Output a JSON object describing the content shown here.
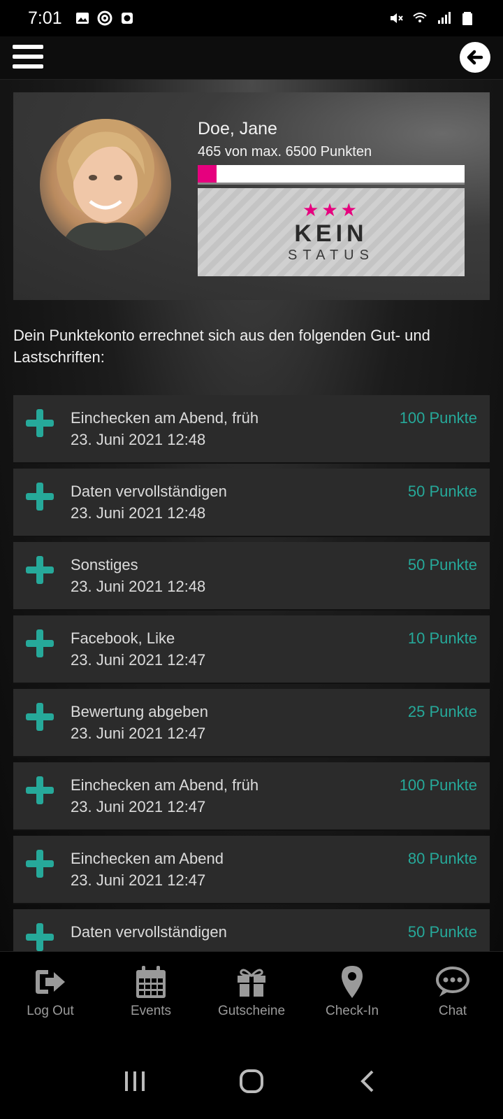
{
  "status_bar": {
    "time": "7:01",
    "icons_left": [
      "image-icon",
      "at-icon",
      "clock-icon"
    ],
    "icons_right": [
      "mute-icon",
      "wifi-icon",
      "signal-icon",
      "battery-icon"
    ]
  },
  "app_bar": {
    "menu_icon": "hamburger-icon",
    "back_icon": "back-arrow-icon"
  },
  "profile": {
    "name": "Doe, Jane",
    "points_text": "465  von max. 6500 Punkten",
    "progress_fraction": 0.0715,
    "badge": {
      "title": "KEIN",
      "subtitle": "STATUS",
      "stars": "★★★",
      "star_color": "#e6007e"
    }
  },
  "intro_text": "Dein Punktekonto errechnet sich aus den folgenden Gut- und Lastschriften:",
  "transactions": [
    {
      "title": "Einchecken am Abend, früh",
      "date": "23. Juni 2021 12:48",
      "points": "100 Punkte"
    },
    {
      "title": "Daten vervollständigen",
      "date": "23. Juni 2021 12:48",
      "points": "50 Punkte"
    },
    {
      "title": "Sonstiges",
      "date": "23. Juni 2021 12:48",
      "points": "50 Punkte"
    },
    {
      "title": "Facebook, Like",
      "date": "23. Juni 2021 12:47",
      "points": "10 Punkte"
    },
    {
      "title": "Bewertung abgeben",
      "date": "23. Juni 2021 12:47",
      "points": "25 Punkte"
    },
    {
      "title": "Einchecken am Abend, früh",
      "date": "23. Juni 2021 12:47",
      "points": "100 Punkte"
    },
    {
      "title": "Einchecken am Abend",
      "date": "23. Juni 2021 12:47",
      "points": "80 Punkte"
    },
    {
      "title": "Daten vervollständigen",
      "date": "",
      "points": "50 Punkte"
    }
  ],
  "bottom_nav": [
    {
      "label": "Log Out",
      "icon": "logout-icon"
    },
    {
      "label": "Events",
      "icon": "calendar-icon"
    },
    {
      "label": "Gutscheine",
      "icon": "gift-icon"
    },
    {
      "label": "Check-In",
      "icon": "location-pin-icon"
    },
    {
      "label": "Chat",
      "icon": "chat-bubble-icon"
    }
  ],
  "colors": {
    "accent_teal": "#26a99a",
    "accent_pink": "#e6007e",
    "nav_icon_gray": "#9a9a9a"
  }
}
